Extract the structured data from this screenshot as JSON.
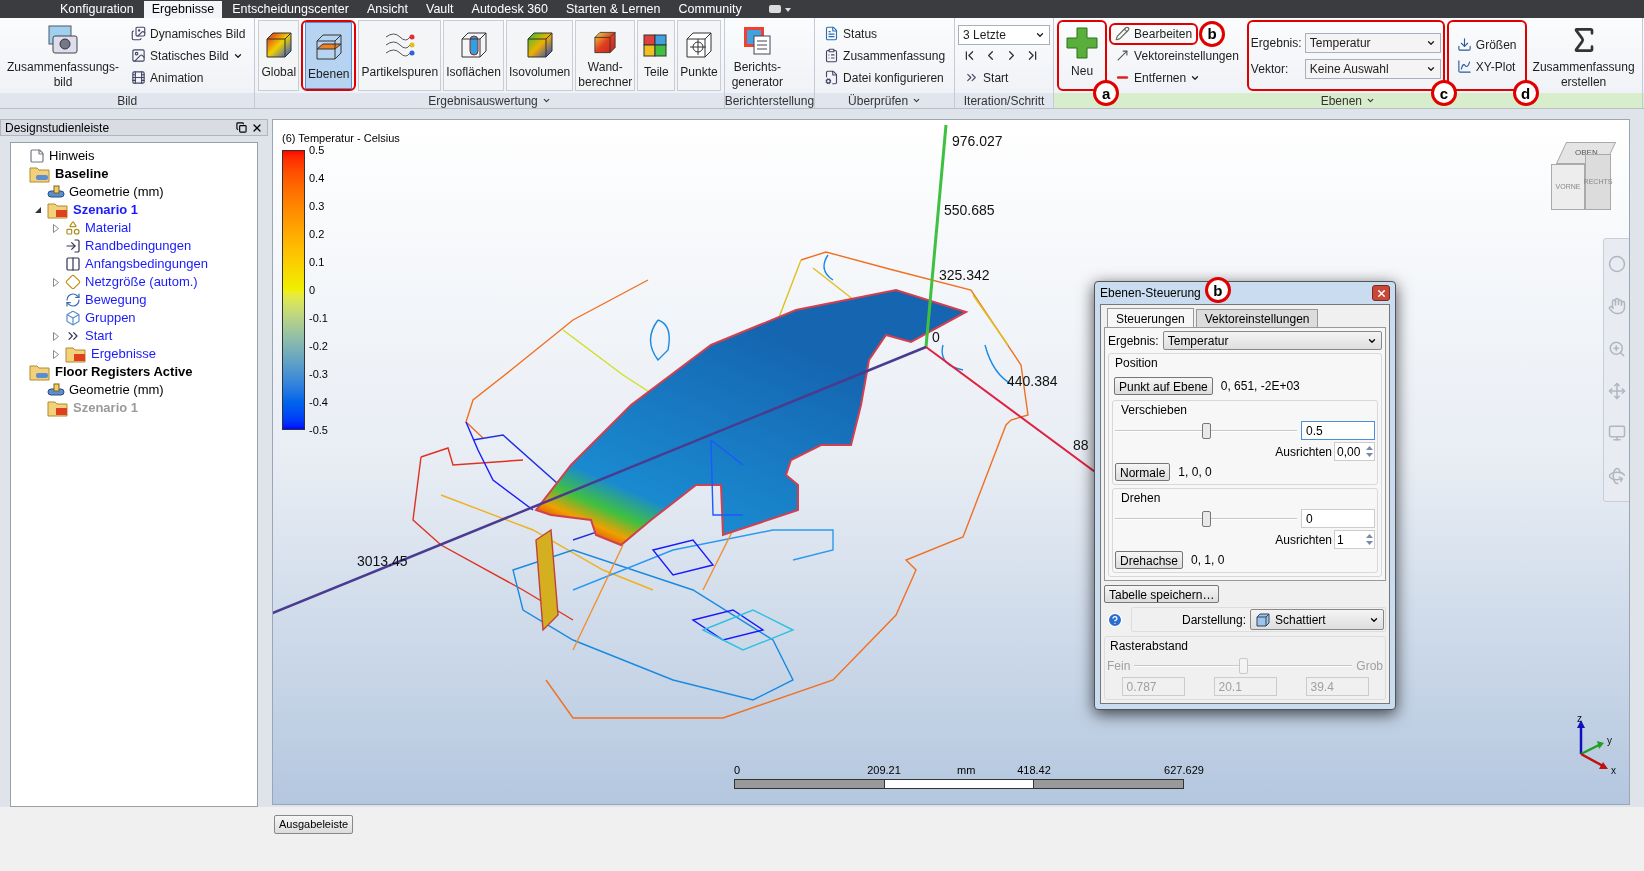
{
  "menu_tabs": [
    {
      "label": "Konfiguration",
      "selected": false
    },
    {
      "label": "Ergebnisse",
      "selected": true
    },
    {
      "label": "Entscheidungscenter",
      "selected": false
    },
    {
      "label": "Ansicht",
      "selected": false
    },
    {
      "label": "Vault",
      "selected": false
    },
    {
      "label": "Autodesk 360",
      "selected": false
    },
    {
      "label": "Starten & Lernen",
      "selected": false
    },
    {
      "label": "Community",
      "selected": false
    }
  ],
  "ribbon_groups": [
    {
      "label": "Bild",
      "menu": false,
      "contextual": false,
      "columns": [
        {
          "highlighted": false,
          "items": [
            {
              "kind": "large",
              "label": "Zusammenfassungs-bild"
            }
          ]
        },
        {
          "highlighted": false,
          "items": [
            {
              "kind": "small",
              "label": "Dynamisches Bild",
              "menu": false,
              "highlighted": false
            },
            {
              "kind": "small",
              "label": "Statisches Bild",
              "menu": true,
              "highlighted": false
            },
            {
              "kind": "small",
              "label": "Animation",
              "menu": false,
              "highlighted": false
            }
          ]
        }
      ]
    },
    {
      "label": "Ergebnisauswertung",
      "menu": true,
      "contextual": false,
      "columns": [
        {
          "highlighted": false,
          "items": [
            {
              "kind": "tool",
              "label": "Global",
              "selected": false
            }
          ]
        },
        {
          "highlighted": true,
          "items": [
            {
              "kind": "tool",
              "label": "Ebenen",
              "selected": true
            }
          ]
        },
        {
          "highlighted": false,
          "items": [
            {
              "kind": "tool",
              "label": "Partikelspuren",
              "selected": false
            }
          ]
        },
        {
          "highlighted": false,
          "items": [
            {
              "kind": "tool",
              "label": "Isoflächen",
              "selected": false
            }
          ]
        },
        {
          "highlighted": false,
          "items": [
            {
              "kind": "tool",
              "label": "Isovolumen",
              "selected": false
            }
          ]
        },
        {
          "highlighted": false,
          "items": [
            {
              "kind": "tool",
              "label": "Wand-berechner",
              "selected": false
            }
          ]
        },
        {
          "highlighted": false,
          "items": [
            {
              "kind": "tool",
              "label": "Teile",
              "selected": false
            }
          ]
        },
        {
          "highlighted": false,
          "items": [
            {
              "kind": "tool",
              "label": "Punkte",
              "selected": false
            }
          ]
        }
      ]
    },
    {
      "label": "Berichterstellung",
      "menu": false,
      "contextual": false,
      "columns": [
        {
          "highlighted": false,
          "items": [
            {
              "kind": "large",
              "label": "Berichts-generator"
            }
          ]
        }
      ]
    },
    {
      "label": "Überprüfen",
      "menu": true,
      "contextual": false,
      "columns": [
        {
          "highlighted": false,
          "items": [
            {
              "kind": "small",
              "label": "Status",
              "menu": false,
              "highlighted": false
            },
            {
              "kind": "small",
              "label": "Zusammenfassung",
              "menu": false,
              "highlighted": false
            },
            {
              "kind": "small",
              "label": "Datei konfigurieren",
              "menu": false,
              "highlighted": false
            }
          ]
        }
      ]
    },
    {
      "label": "Iteration/Schritt",
      "menu": false,
      "contextual": false,
      "columns": [
        {
          "highlighted": false,
          "items": [
            {
              "kind": "combo",
              "value": "3 Letzte"
            },
            {
              "kind": "stepper"
            },
            {
              "kind": "small",
              "label": "Start",
              "menu": false,
              "highlighted": false
            }
          ]
        }
      ]
    },
    {
      "label": "Ebenen",
      "menu": true,
      "contextual": true,
      "columns": [
        {
          "highlighted": true,
          "callout": "a",
          "items": [
            {
              "kind": "large",
              "label": "Neu"
            }
          ]
        },
        {
          "highlighted": false,
          "items": [
            {
              "kind": "small",
              "label": "Bearbeiten",
              "menu": false,
              "highlighted": true,
              "callout": "b"
            },
            {
              "kind": "small",
              "label": "Vektoreinstellungen",
              "menu": false,
              "highlighted": false
            },
            {
              "kind": "small",
              "label": "Entfernen",
              "menu": true,
              "highlighted": false
            }
          ]
        },
        {
          "highlighted": true,
          "callout": "c",
          "items": [
            {
              "kind": "field",
              "label": "Ergebnis:",
              "value": "Temperatur"
            },
            {
              "kind": "field",
              "label": "Vektor:",
              "value": "Keine Auswahl"
            }
          ]
        },
        {
          "highlighted": true,
          "callout": "d",
          "items": [
            {
              "kind": "small",
              "label": "Größen",
              "menu": false,
              "highlighted": false
            },
            {
              "kind": "small",
              "label": "XY-Plot",
              "menu": false,
              "highlighted": false
            }
          ]
        },
        {
          "highlighted": false,
          "items": [
            {
              "kind": "large",
              "label": "Zusammenfassung erstellen"
            }
          ]
        }
      ]
    }
  ],
  "panel": {
    "title": "Designstudienleiste",
    "tree": [
      {
        "kind": "note",
        "label": "Hinweis"
      },
      {
        "kind": "study",
        "label": "Baseline",
        "children": [
          {
            "kind": "geometry",
            "label": "Geometrie (mm)"
          },
          {
            "kind": "scenario",
            "label": "Szenario 1",
            "active": true,
            "expanded": true,
            "children": [
              {
                "kind": "material",
                "label": "Material",
                "expanded": false
              },
              {
                "kind": "boundary",
                "label": "Randbedingungen"
              },
              {
                "kind": "initial",
                "label": "Anfangsbedingungen"
              },
              {
                "kind": "mesh",
                "label": "Netzgröße (autom.)",
                "expanded": false
              },
              {
                "kind": "motion",
                "label": "Bewegung"
              },
              {
                "kind": "groups",
                "label": "Gruppen"
              },
              {
                "kind": "run",
                "label": "Start",
                "expanded": false
              },
              {
                "kind": "results",
                "label": "Ergebnisse",
                "expanded": false
              }
            ]
          }
        ]
      },
      {
        "kind": "study",
        "label": "Floor Registers Active",
        "children": [
          {
            "kind": "geometry",
            "label": "Geometrie (mm)"
          },
          {
            "kind": "scenario",
            "label": "Szenario 1",
            "active": false
          }
        ]
      }
    ]
  },
  "viewport": {
    "legend": {
      "title": "(6) Temperatur - Celsius",
      "ticks": [
        "0.5",
        "0.4",
        "0.3",
        "0.2",
        "0.1",
        "0",
        "-0.1",
        "-0.2",
        "-0.3",
        "-0.4",
        "-0.5"
      ]
    },
    "axis_marks": [
      {
        "label": "976.027"
      },
      {
        "label": "550.685"
      },
      {
        "label": "325.342"
      },
      {
        "label": "0"
      },
      {
        "label": "440.384"
      },
      {
        "label": "88"
      },
      {
        "label": "3013.45"
      }
    ],
    "scale_bar": {
      "labels": [
        "0",
        "209.21",
        "418.42",
        "627.629"
      ],
      "unit": "mm"
    },
    "view_cube": [
      "OBEN",
      "VORNE",
      "RECHTS"
    ],
    "triad": [
      "z",
      "y",
      "x"
    ]
  },
  "dialog": {
    "title": "Ebenen-Steuerung",
    "callout": "b",
    "tabs": [
      {
        "label": "Steuerungen",
        "selected": true
      },
      {
        "label": "Vektoreinstellungen",
        "selected": false
      }
    ],
    "result": {
      "label": "Ergebnis:",
      "value": "Temperatur"
    },
    "position": {
      "title": "Position",
      "button": "Punkt auf Ebene",
      "value": "0, 651, -2E+03"
    },
    "sections": [
      {
        "title": "Verschieben",
        "level": 0.5,
        "value": "0.5",
        "focused": true,
        "align_label": "Ausrichten",
        "align_value": "0,00",
        "button": "Normale",
        "vector": "1, 0, 0"
      },
      {
        "title": "Drehen",
        "level": 0.5,
        "value": "0",
        "focused": false,
        "align_label": "Ausrichten",
        "align_value": "1",
        "button": "Drehachse",
        "vector": "0, 1, 0"
      }
    ],
    "save_button": "Tabelle speichern…",
    "display": {
      "label": "Darstellung:",
      "value": "Schattiert"
    },
    "grid": {
      "title": "Rasterabstand",
      "disabled": true,
      "min_label": "Fein",
      "max_label": "Grob",
      "level": 0.5,
      "values": [
        "0.787",
        "20.1",
        "39.4"
      ]
    }
  },
  "output_button": "Ausgabeleiste"
}
